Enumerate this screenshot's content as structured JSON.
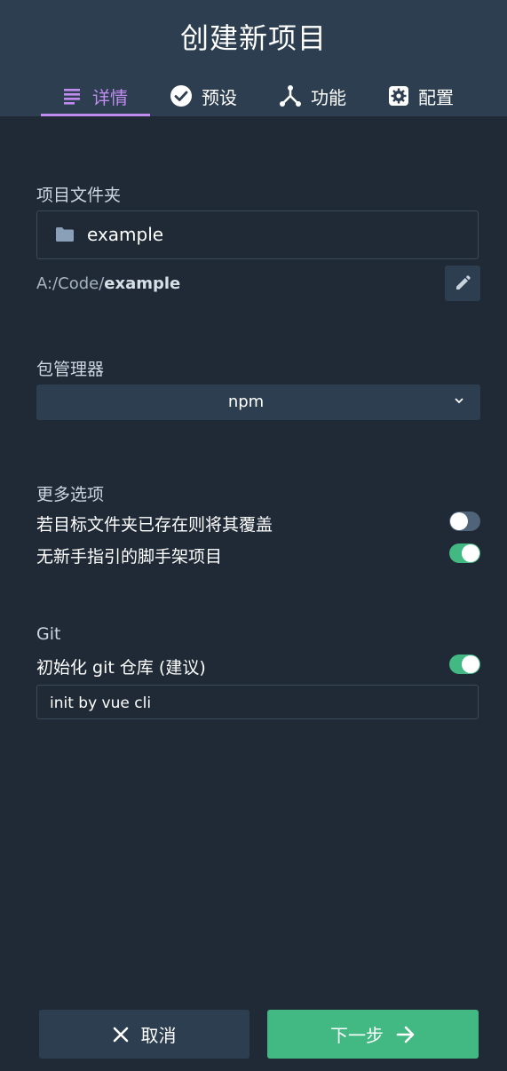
{
  "header": {
    "title": "创建新项目",
    "tabs": [
      {
        "label": "详情",
        "icon": "details-list-icon",
        "active": true
      },
      {
        "label": "预设",
        "icon": "check-circle-icon",
        "active": false
      },
      {
        "label": "功能",
        "icon": "fork-icon",
        "active": false
      },
      {
        "label": "配置",
        "icon": "gear-icon",
        "active": false
      }
    ]
  },
  "folder": {
    "label": "项目文件夹",
    "value": "example",
    "path_prefix": "A:/Code/",
    "path_name": "example",
    "icon": "folder-icon",
    "edit_icon": "pencil-icon"
  },
  "package_manager": {
    "label": "包管理器",
    "selected": "npm"
  },
  "more_options": {
    "label": "更多选项",
    "items": [
      {
        "label": "若目标文件夹已存在则将其覆盖",
        "enabled": false
      },
      {
        "label": "无新手指引的脚手架项目",
        "enabled": true
      }
    ]
  },
  "git": {
    "label": "Git",
    "init_label": "初始化 git 仓库 (建议)",
    "init_enabled": true,
    "commit_message": "init by vue cli"
  },
  "footer": {
    "cancel_label": "取消",
    "next_label": "下一步"
  },
  "colors": {
    "background": "#1f2a36",
    "header": "#2c3e50",
    "accent_tab": "#c08cf0",
    "primary": "#42b883"
  }
}
